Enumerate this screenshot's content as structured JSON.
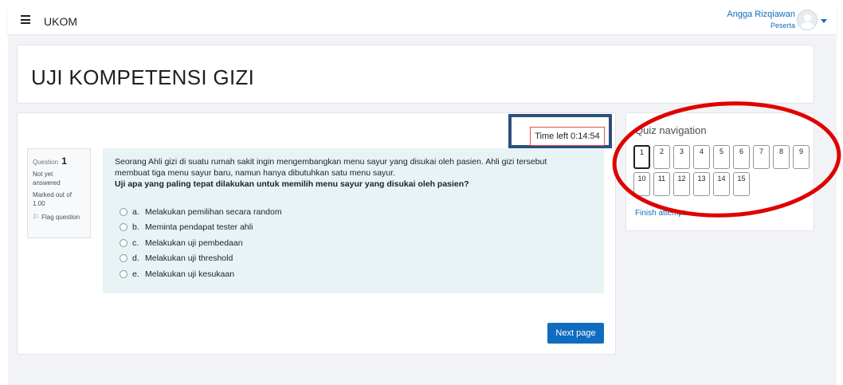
{
  "navbar": {
    "menu_icon": "hamburger-icon",
    "brand": "UKOM",
    "user_name": "Angga Rizqiawan",
    "user_role": "Peserta"
  },
  "header": {
    "title": "UJI KOMPETENSI GIZI"
  },
  "timer": {
    "text": "Time left 0:14:54"
  },
  "question_info": {
    "label": "Question",
    "number": "1",
    "status_line1": "Not yet",
    "status_line2": "answered",
    "marks_line1": "Marked out of",
    "marks_line2": "1.00",
    "flag_label": "Flag question"
  },
  "question": {
    "text_line1": "Seorang Ahli gizi di suatu rumah sakit ingin mengembangkan menu sayur yang disukai oleh pasien. Ahli gizi tersebut",
    "text_line2": "membuat tiga menu sayur baru, namun hanya dibutuhkan satu menu sayur.",
    "prompt": "Uji apa yang paling tepat dilakukan untuk memilih menu sayur yang disukai oleh pasien?",
    "answers": [
      {
        "letter": "a.",
        "text": "Melakukan pemilihan secara random"
      },
      {
        "letter": "b.",
        "text": "Meminta pendapat tester ahli"
      },
      {
        "letter": "c.",
        "text": "Melakukan uji pembedaan"
      },
      {
        "letter": "d.",
        "text": "Melakukan uji threshold"
      },
      {
        "letter": "e.",
        "text": "Melakukan uji kesukaan"
      }
    ]
  },
  "next_button": "Next page",
  "quiz_nav": {
    "title": "Quiz navigation",
    "buttons": [
      "1",
      "2",
      "3",
      "4",
      "5",
      "6",
      "7",
      "8",
      "9",
      "10",
      "11",
      "12",
      "13",
      "14",
      "15"
    ],
    "current": "1",
    "finish_link": "Finish attempt ..."
  },
  "colors": {
    "accent": "#0f6cbf",
    "annotation_red": "#e00000",
    "annotation_box": "#2d4f7c",
    "question_bg": "#e7f3f5"
  }
}
